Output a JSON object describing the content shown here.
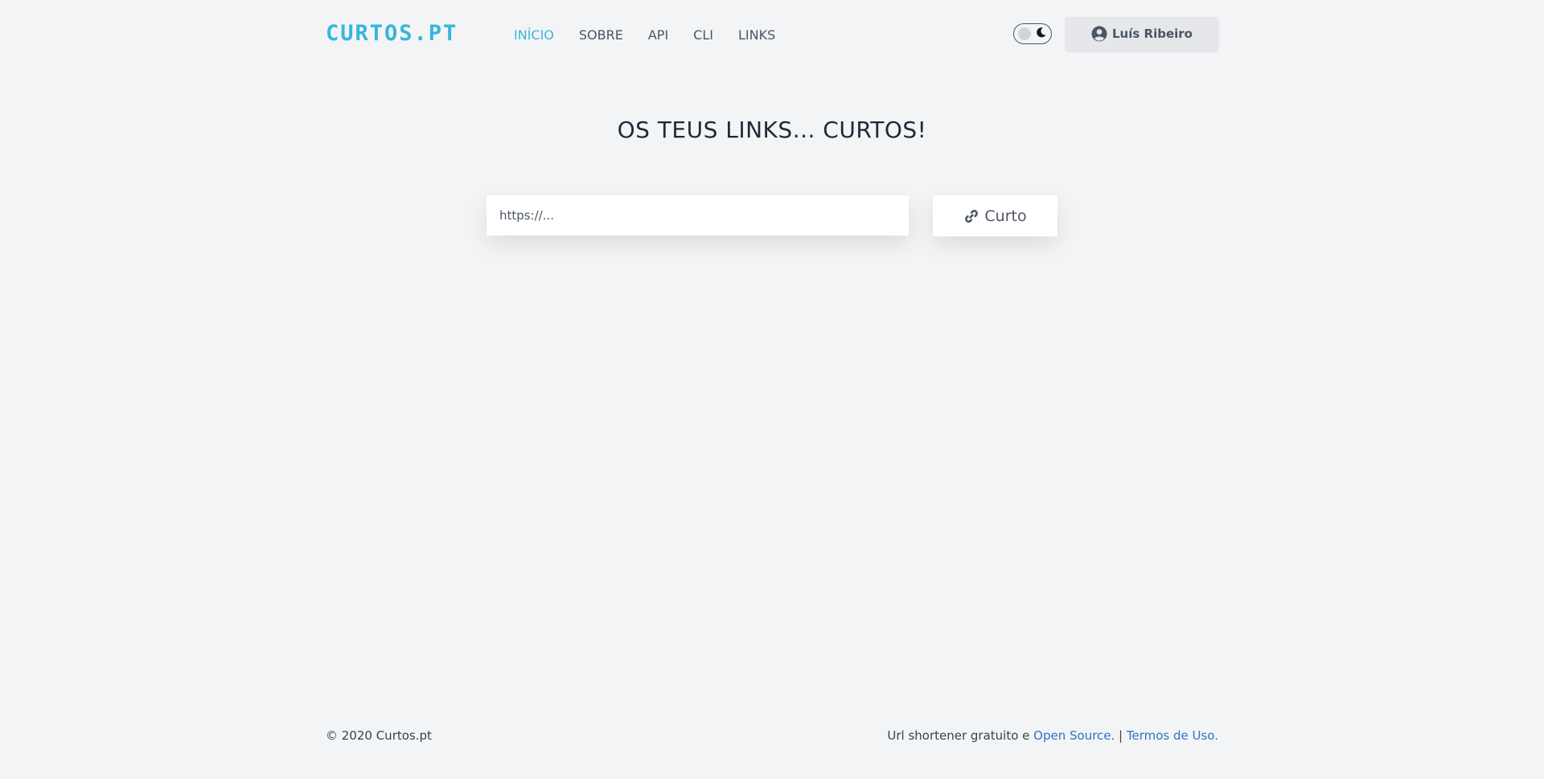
{
  "header": {
    "logo": "CURTOS.PT",
    "nav": [
      {
        "label": "INÍCIO",
        "active": true
      },
      {
        "label": "SOBRE",
        "active": false
      },
      {
        "label": "API",
        "active": false
      },
      {
        "label": "CLI",
        "active": false
      },
      {
        "label": "LINKS",
        "active": false
      }
    ],
    "theme_toggle_icon": "moon-icon",
    "user_name": "Luís Ribeiro",
    "user_icon": "user-circle-icon"
  },
  "main": {
    "title": "OS TEUS LINKS... CURTOS!",
    "url_input_placeholder": "https://...",
    "url_input_value": "",
    "shorten_button_label": "Curto",
    "shorten_button_icon": "link-icon"
  },
  "footer": {
    "copyright": "© 2020 Curtos.pt",
    "text_prefix": "Url shortener gratuito e ",
    "open_source_link": "Open Source.",
    "separator": " | ",
    "terms_link": "Termos de Uso."
  },
  "colors": {
    "background": "#f3f4f6",
    "accent": "#36b6dc",
    "link": "#2f72c4",
    "text": "#4b5563"
  }
}
